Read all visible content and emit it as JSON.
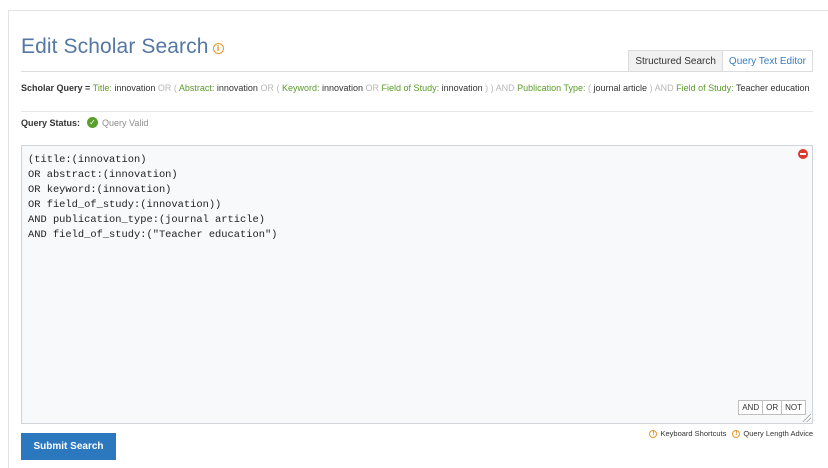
{
  "header": {
    "title": "Edit Scholar Search",
    "info_glyph": "i"
  },
  "tabs": [
    {
      "label": "Structured Search",
      "active": false
    },
    {
      "label": "Query Text Editor",
      "active": true
    }
  ],
  "query_summary": {
    "label": "Scholar Query",
    "equals": "=",
    "parts": [
      {
        "t": "fld",
        "v": "Title:"
      },
      {
        "t": "val",
        "v": " innovation "
      },
      {
        "t": "op",
        "v": "OR ( "
      },
      {
        "t": "fld",
        "v": "Abstract:"
      },
      {
        "t": "val",
        "v": " innovation "
      },
      {
        "t": "op",
        "v": "OR ( "
      },
      {
        "t": "fld",
        "v": "Keyword:"
      },
      {
        "t": "val",
        "v": " innovation "
      },
      {
        "t": "op",
        "v": "OR "
      },
      {
        "t": "fld",
        "v": "Field of Study:"
      },
      {
        "t": "val",
        "v": " innovation "
      },
      {
        "t": "op",
        "v": ") ) AND "
      },
      {
        "t": "fld",
        "v": "Publication Type:"
      },
      {
        "t": "op",
        "v": " ( "
      },
      {
        "t": "val",
        "v": "journal article "
      },
      {
        "t": "op",
        "v": ") AND "
      },
      {
        "t": "fld",
        "v": "Field of Study:"
      },
      {
        "t": "val",
        "v": " Teacher education"
      }
    ]
  },
  "status": {
    "label": "Query Status:",
    "check_glyph": "✓",
    "value": "Query Valid"
  },
  "editor": {
    "lines": [
      "(title:(innovation)",
      "OR abstract:(innovation)",
      "OR keyword:(innovation)",
      "OR field_of_study:(innovation))",
      "AND publication_type:(journal article)",
      "AND field_of_study:(\"Teacher education\")"
    ],
    "operators": [
      "AND",
      "OR",
      "NOT"
    ]
  },
  "helpers": [
    {
      "label": "Keyboard Shortcuts",
      "icon": "info-icon"
    },
    {
      "label": "Query Length Advice",
      "icon": "info-icon"
    }
  ],
  "submit_label": "Submit Search",
  "colors": {
    "title": "#5577a3",
    "field": "#5a9b2a",
    "operator": "#b8b8b8",
    "accent": "#2c78bf",
    "warning": "#e7972a",
    "valid": "#5aa02c",
    "remove": "#d83a2e"
  }
}
